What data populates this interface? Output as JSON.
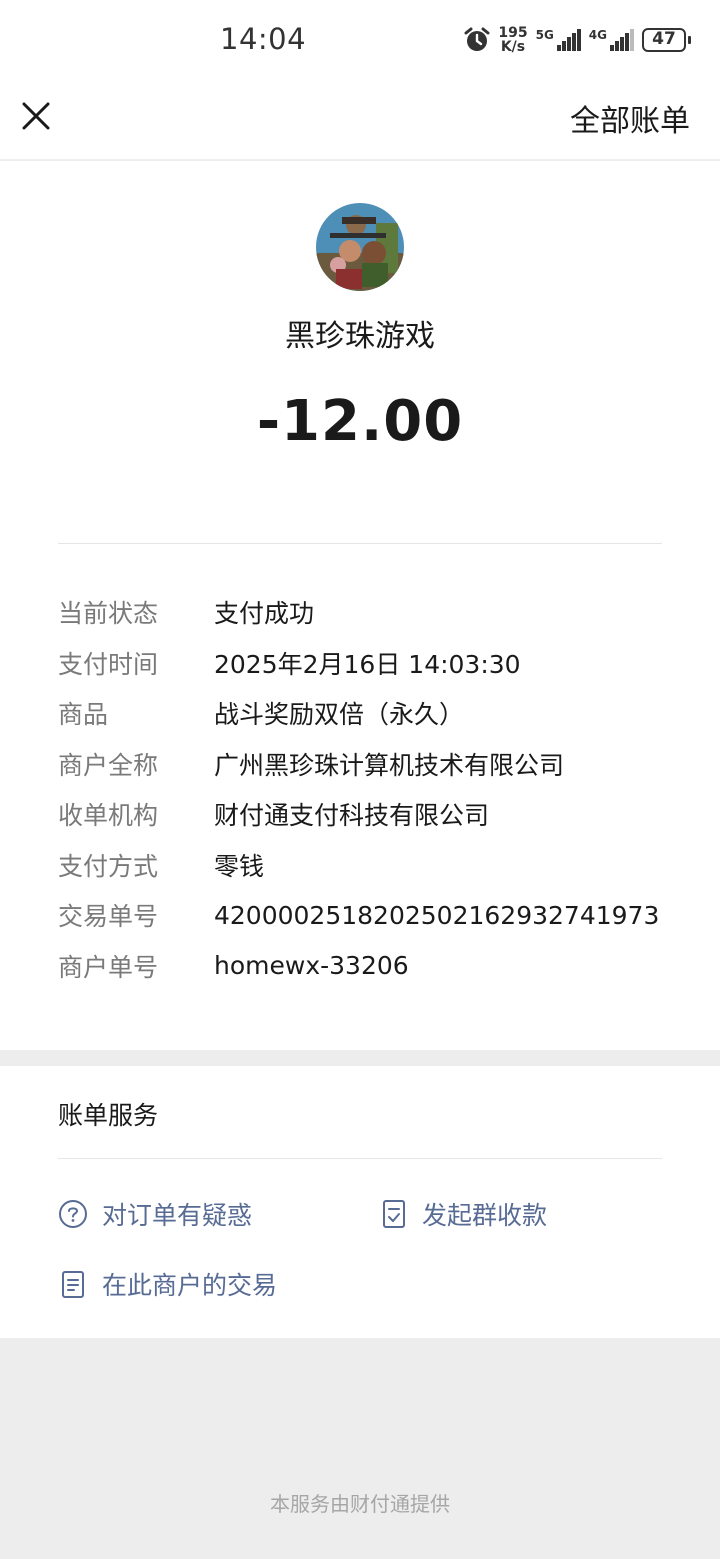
{
  "status_bar": {
    "time": "14:04",
    "speed_value": "195",
    "speed_unit": "K/s",
    "net1": "5G",
    "net2": "4G",
    "battery": "47"
  },
  "header": {
    "all_bills": "全部账单"
  },
  "merchant": {
    "name": "黑珍珠游戏",
    "amount": "-12.00"
  },
  "details": [
    {
      "label": "当前状态",
      "value": "支付成功"
    },
    {
      "label": "支付时间",
      "value": "2025年2月16日 14:03:30"
    },
    {
      "label": "商品",
      "value": "战斗奖励双倍（永久）"
    },
    {
      "label": "商户全称",
      "value": "广州黑珍珠计算机技术有限公司"
    },
    {
      "label": "收单机构",
      "value": "财付通支付科技有限公司"
    },
    {
      "label": "支付方式",
      "value": "零钱"
    },
    {
      "label": "交易单号",
      "value": "4200002518202502162932741973"
    },
    {
      "label": "商户单号",
      "value": "homewx-33206"
    }
  ],
  "services": {
    "title": "账单服务",
    "question": "对订单有疑惑",
    "group_collect": "发起群收款",
    "merchant_trades": "在此商户的交易"
  },
  "footer": "本服务由财付通提供",
  "colors": {
    "link": "#576b95",
    "label": "#7a7a7a",
    "background": "#ededed"
  }
}
